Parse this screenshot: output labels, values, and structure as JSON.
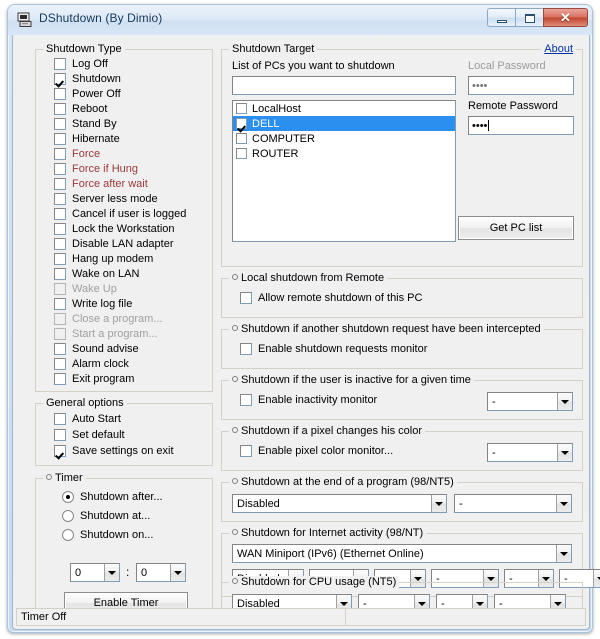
{
  "window": {
    "title": "DShutdown (By Dimio)",
    "icon": "computer-icon",
    "minimize": "–",
    "maximize": "□",
    "close": "✕"
  },
  "shutdown_type": {
    "legend": "Shutdown Type",
    "items": [
      {
        "label": "Log Off",
        "checked": false,
        "state": "normal"
      },
      {
        "label": "Shutdown",
        "checked": true,
        "state": "normal"
      },
      {
        "label": "Power Off",
        "checked": false,
        "state": "normal"
      },
      {
        "label": "Reboot",
        "checked": false,
        "state": "normal"
      },
      {
        "label": "Stand By",
        "checked": false,
        "state": "normal"
      },
      {
        "label": "Hibernate",
        "checked": false,
        "state": "normal"
      },
      {
        "label": "Force",
        "checked": false,
        "state": "red"
      },
      {
        "label": "Force if Hung",
        "checked": false,
        "state": "red"
      },
      {
        "label": "Force after wait",
        "checked": false,
        "state": "red"
      },
      {
        "label": "Server less mode",
        "checked": false,
        "state": "normal"
      },
      {
        "label": "Cancel if user is logged",
        "checked": false,
        "state": "normal"
      },
      {
        "label": "Lock the Workstation",
        "checked": false,
        "state": "normal"
      },
      {
        "label": "Disable LAN adapter",
        "checked": false,
        "state": "normal"
      },
      {
        "label": "Hang up modem",
        "checked": false,
        "state": "normal"
      },
      {
        "label": "Wake on LAN",
        "checked": false,
        "state": "normal"
      },
      {
        "label": "Wake Up",
        "checked": false,
        "state": "disabled"
      },
      {
        "label": "Write log file",
        "checked": false,
        "state": "normal"
      },
      {
        "label": "Close a program...",
        "checked": false,
        "state": "disabled"
      },
      {
        "label": "Start a program...",
        "checked": false,
        "state": "disabled"
      },
      {
        "label": "Sound advise",
        "checked": false,
        "state": "normal"
      },
      {
        "label": "Alarm clock",
        "checked": false,
        "state": "normal"
      },
      {
        "label": "Exit program",
        "checked": false,
        "state": "normal"
      }
    ]
  },
  "general_options": {
    "legend": "General options",
    "items": [
      {
        "label": "Auto Start",
        "checked": false
      },
      {
        "label": "Set default",
        "checked": false
      },
      {
        "label": "Save settings on exit",
        "checked": true
      }
    ]
  },
  "timer": {
    "legend": "Timer",
    "radios": [
      {
        "label": "Shutdown after...",
        "selected": true
      },
      {
        "label": "Shutdown at...",
        "selected": false
      },
      {
        "label": "Shutdown on...",
        "selected": false
      }
    ],
    "hours": "0",
    "separator": ":",
    "minutes": "0",
    "enable_button": "Enable Timer"
  },
  "shutdown_target": {
    "legend": "Shutdown Target",
    "about_link": "About",
    "list_label": "List of PCs you want to shutdown",
    "pc_input_value": "",
    "local_password_label": "Local Password",
    "local_password_value": "••••",
    "remote_password_label": "Remote Password",
    "remote_password_value": "••••",
    "get_pc_list_button": "Get PC list",
    "pcs": [
      {
        "name": "LocalHost",
        "checked": false,
        "selected": false
      },
      {
        "name": "DELL",
        "checked": true,
        "selected": true
      },
      {
        "name": "COMPUTER",
        "checked": false,
        "selected": false
      },
      {
        "name": "ROUTER",
        "checked": false,
        "selected": false
      }
    ]
  },
  "local_remote": {
    "legend": "Local shutdown from Remote",
    "checkbox_label": "Allow remote shutdown of this PC",
    "checked": false
  },
  "intercepted": {
    "legend": "Shutdown if another shutdown request have been intercepted",
    "checkbox_label": "Enable shutdown requests monitor",
    "checked": false
  },
  "inactivity": {
    "legend": "Shutdown if the user is inactive for a given time",
    "checkbox_label": "Enable inactivity monitor",
    "checked": false,
    "combo_value": "-"
  },
  "pixel_color": {
    "legend": "Shutdown if a pixel changes his color",
    "checkbox_label": "Enable pixel color monitor...",
    "checked": false,
    "combo_value": "-"
  },
  "end_of_program": {
    "legend": "Shutdown at the end of a program (98/NT5)",
    "combo_main": "Disabled",
    "combo_second": "-"
  },
  "internet_activity": {
    "legend": "Shutdown for Internet activity (98/NT)",
    "adapter": "WAN Miniport (IPv6) (Ethernet Online)",
    "combos": [
      "Disabled",
      "-",
      "-",
      "-",
      "-",
      "-"
    ]
  },
  "cpu_usage": {
    "legend": "Shutdown for CPU usage (NT5)",
    "combos": [
      "Disabled",
      "-",
      "-",
      "-"
    ]
  },
  "statusbar": {
    "left": "Timer Off",
    "right": ""
  },
  "colors": {
    "selection": "#2a8fef",
    "force_red": "#9c3a3a",
    "disabled_gray": "#a0a0a0",
    "link_blue": "#0033aa"
  }
}
